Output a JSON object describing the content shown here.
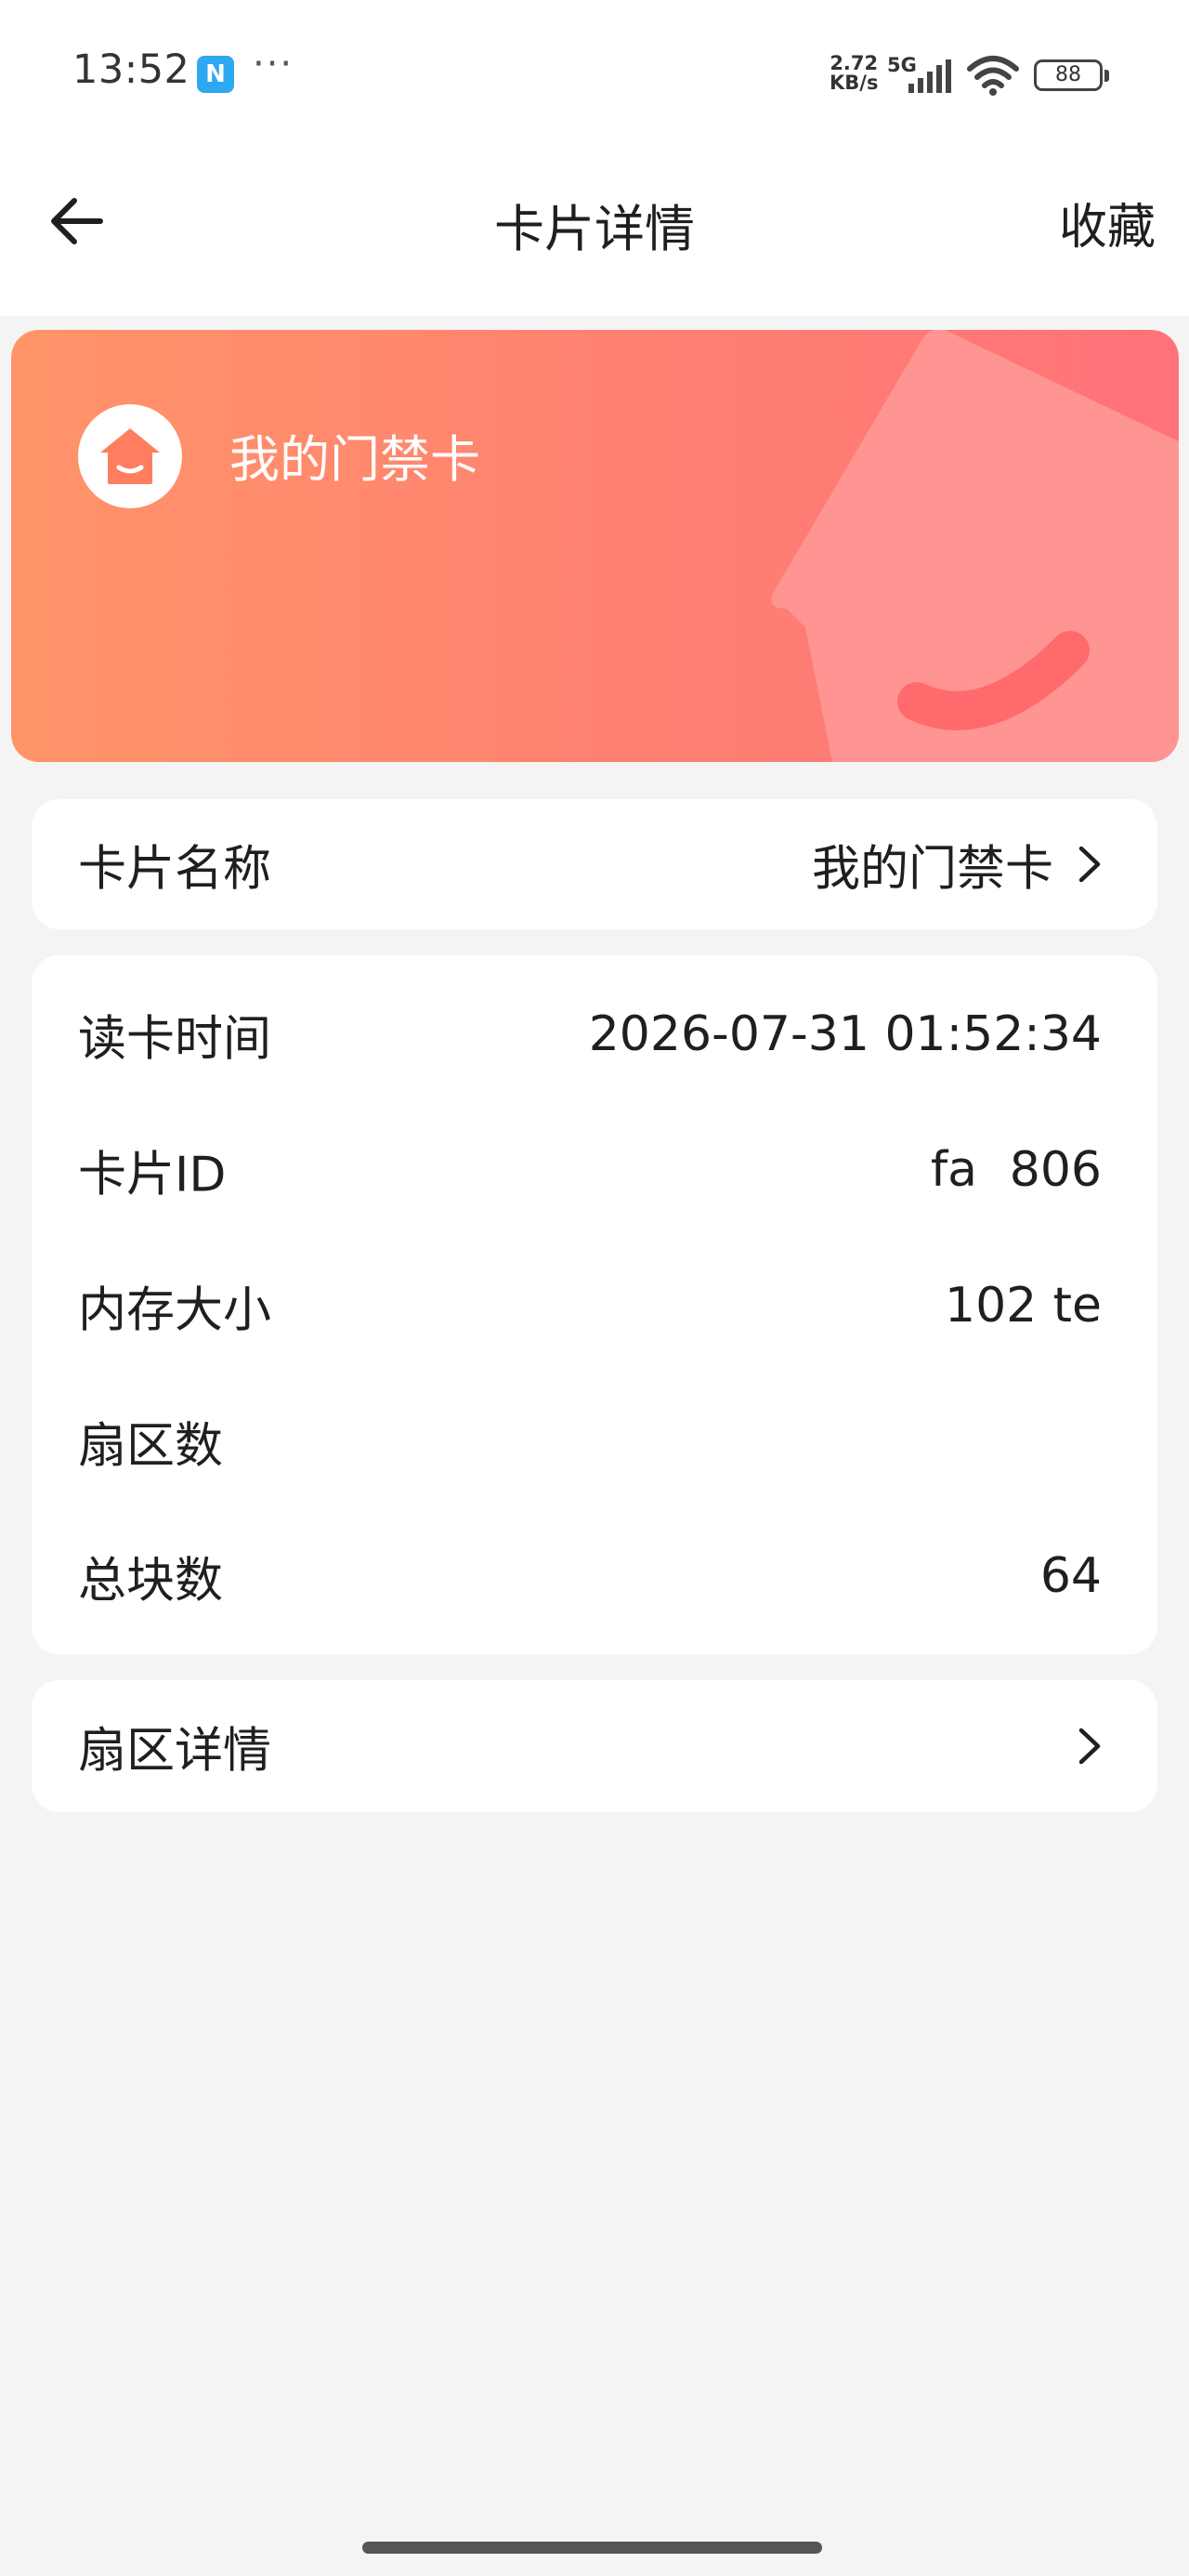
{
  "status_bar": {
    "time": "13:52",
    "nfc_label": "N",
    "more": "···",
    "net_speed_value": "2.72",
    "net_speed_unit": "KB/s",
    "network_type": "5G",
    "battery_level": "88",
    "icons": [
      "nfc-icon",
      "signal-icon",
      "wifi-icon",
      "battery-icon"
    ]
  },
  "header": {
    "title": "卡片详情",
    "favorite_label": "收藏",
    "back_icon": "arrow-left-icon"
  },
  "card": {
    "title": "我的门禁卡",
    "icon": "home-icon",
    "colors": {
      "gradient_start": "#ff9468",
      "gradient_end": "#ff7279",
      "decoration": "#ff9592",
      "smile": "#ff6a6c"
    }
  },
  "name_section": {
    "label": "卡片名称",
    "value": "我的门禁卡"
  },
  "details": {
    "rows": [
      {
        "label": "读卡时间",
        "value": "2026-07-31 01:52:34"
      },
      {
        "label": "卡片ID",
        "value": "fa    806"
      },
      {
        "label": "内存大小",
        "value": "102  te"
      },
      {
        "label": "扇区数",
        "value": ""
      },
      {
        "label": "总块数",
        "value": "64"
      }
    ]
  },
  "sector_section": {
    "label": "扇区详情"
  }
}
